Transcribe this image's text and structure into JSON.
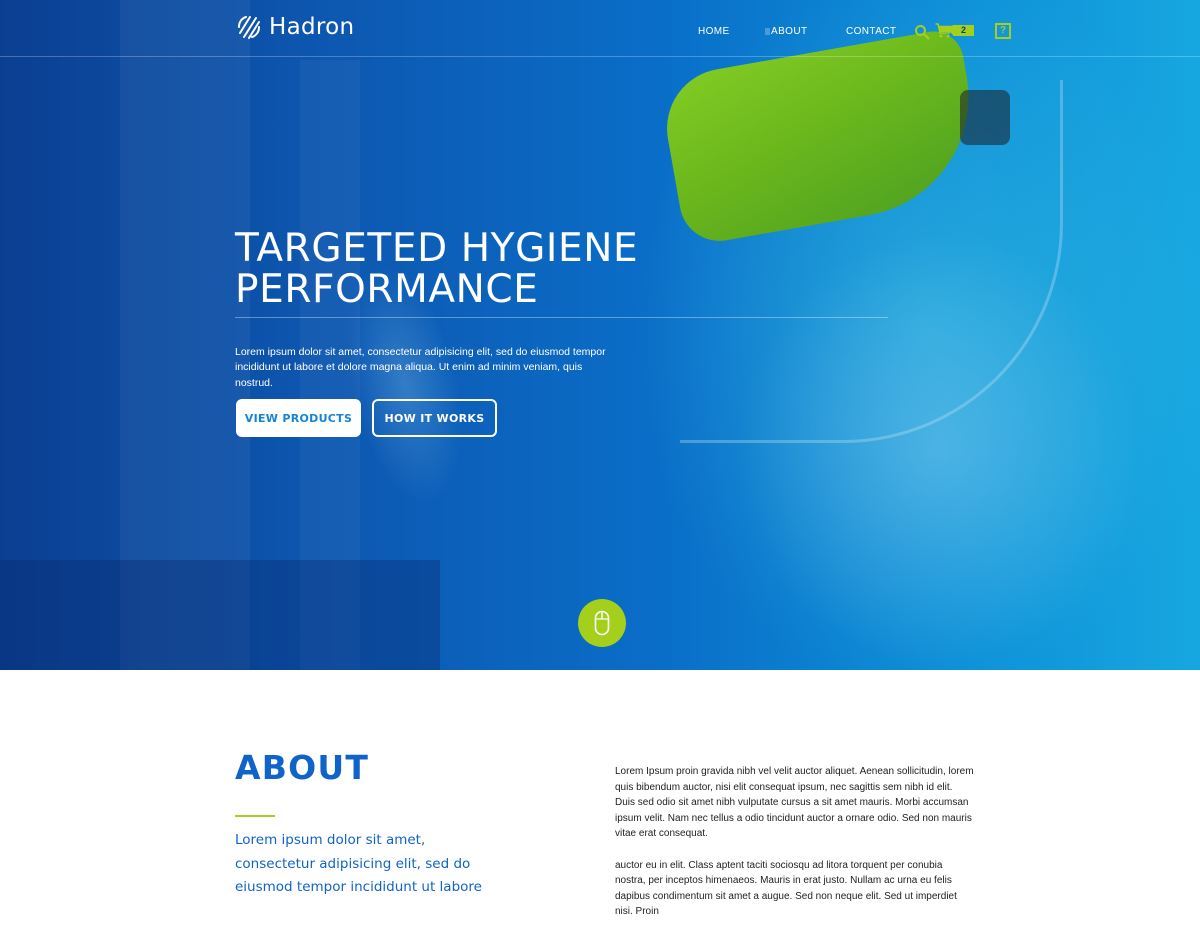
{
  "brand": {
    "name": "Hadron",
    "accent_color": "#a4cf1a",
    "primary_color": "#1063c9",
    "logo_icon": "diagonal-stripes-circle-icon"
  },
  "nav": {
    "items": [
      {
        "label": "HOME"
      },
      {
        "label": "ABOUT"
      },
      {
        "label": "CONTACT"
      }
    ],
    "search_icon": "search-icon",
    "cart_icon": "cart-icon",
    "cart_count": "2",
    "help_icon": "help-icon",
    "help_label": "?"
  },
  "hero": {
    "title_line1": "TARGETED HYGIENE",
    "title_line2": "PERFORMANCE",
    "text": "Lorem ipsum dolor sit amet, consectetur adipisicing elit, sed do eiusmod tempor incididunt ut labore et dolore magna aliqua. Ut enim ad minim veniam, quis nostrud.",
    "buttons": {
      "primary": "VIEW PRODUCTS",
      "secondary": "HOW IT WORKS"
    },
    "scroll_icon": "mouse-icon"
  },
  "about": {
    "title": "ABOUT",
    "lead": "Lorem ipsum dolor sit amet, consectetur adipisicing elit, sed do eiusmod tempor incididunt ut labore",
    "paragraphs": [
      "Lorem Ipsum proin gravida nibh vel velit auctor aliquet. Aenean sollicitudin, lorem quis bibendum auctor, nisi elit consequat ipsum, nec sagittis sem nibh id elit. Duis sed odio sit amet nibh vulputate cursus a sit amet mauris. Morbi accumsan ipsum velit. Nam nec tellus a odio tincidunt auctor a ornare odio. Sed non  mauris vitae erat consequat.",
      "auctor eu in elit. Class aptent taciti sociosqu ad litora torquent per conubia nostra, per inceptos himenaeos. Mauris in erat justo. Nullam ac urna eu felis dapibus condimentum sit amet a augue. Sed non neque elit. Sed ut imperdiet nisi. Proin"
    ]
  }
}
